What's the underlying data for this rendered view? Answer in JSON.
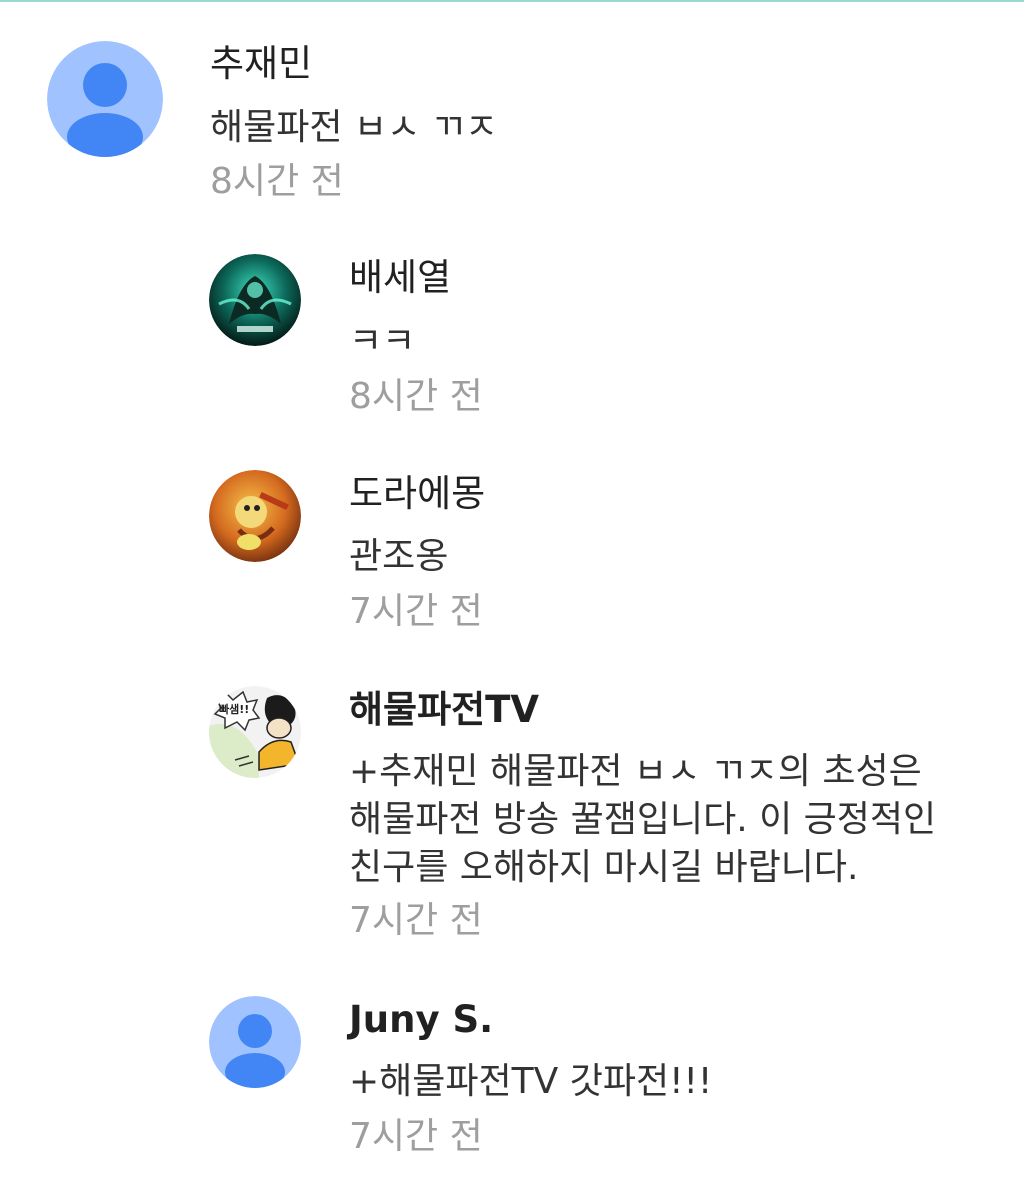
{
  "comments": [
    {
      "author": "추재민",
      "text": "해물파전 ㅂㅅ ㄲㅈ",
      "time": "8시간 전",
      "avatar": "default-user-icon"
    },
    {
      "author": "배세열",
      "text": "ㅋㅋ",
      "time": "8시간 전",
      "avatar": "thresh-avatar-image"
    },
    {
      "author": "도라에몽",
      "text": "관조옹",
      "time": "7시간 전",
      "avatar": "doraemon-avatar-image"
    },
    {
      "author": "해물파전TV",
      "text": "+추재민 해물파전 ㅂㅅ ㄲㅈ의 초성은\n해물파전 방송 꿀잼입니다. 이 긍정적인\n친구를 오해하지 마시길 바랍니다.",
      "time": "7시간 전",
      "avatar": "cartoon-avatar-image",
      "avatar_text": "빠샘!!"
    },
    {
      "author": "Juny S.",
      "text": "+해물파전TV 갓파전!!!",
      "time": "7시간 전",
      "avatar": "default-user-icon"
    }
  ],
  "colors": {
    "default_avatar_bg": "#a0c3ff",
    "default_avatar_fg": "#4285f4",
    "author": "#212121",
    "text": "#333333",
    "time": "#9e9e9e",
    "top_divider": "#9fd8cf"
  }
}
